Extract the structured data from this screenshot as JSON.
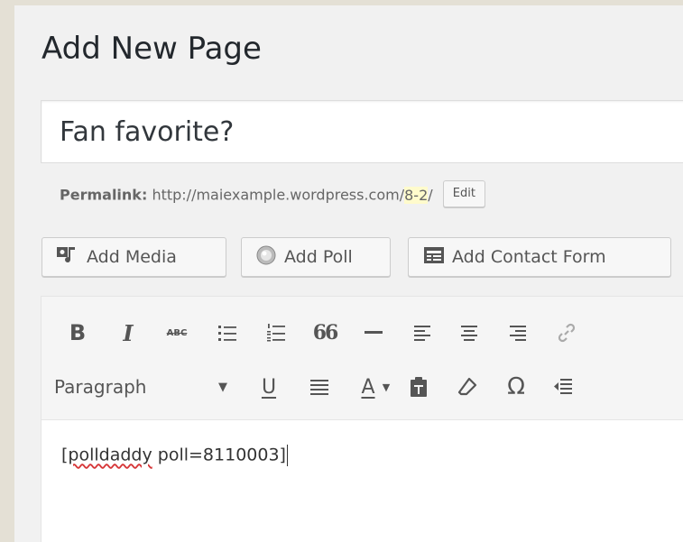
{
  "header": {
    "title": "Add New Page"
  },
  "post_title": {
    "value": "Fan favorite?"
  },
  "permalink": {
    "label": "Permalink:",
    "url_base": "http://maiexample.wordpress.com/",
    "slug": "8-2",
    "url_end": "/",
    "edit_label": "Edit"
  },
  "media_buttons": {
    "add_media": "Add Media",
    "add_poll": "Add Poll",
    "add_contact_form": "Add Contact Form"
  },
  "toolbar": {
    "bold": "B",
    "italic": "I",
    "strikethrough": "ABC",
    "blockquote": "66",
    "omega": "Ω",
    "format_select": "Paragraph",
    "underline": "U",
    "text_color": "A"
  },
  "editor": {
    "spell_word": "polldaddy",
    "content_open": "[",
    "content_rest": " poll=8110003]"
  }
}
